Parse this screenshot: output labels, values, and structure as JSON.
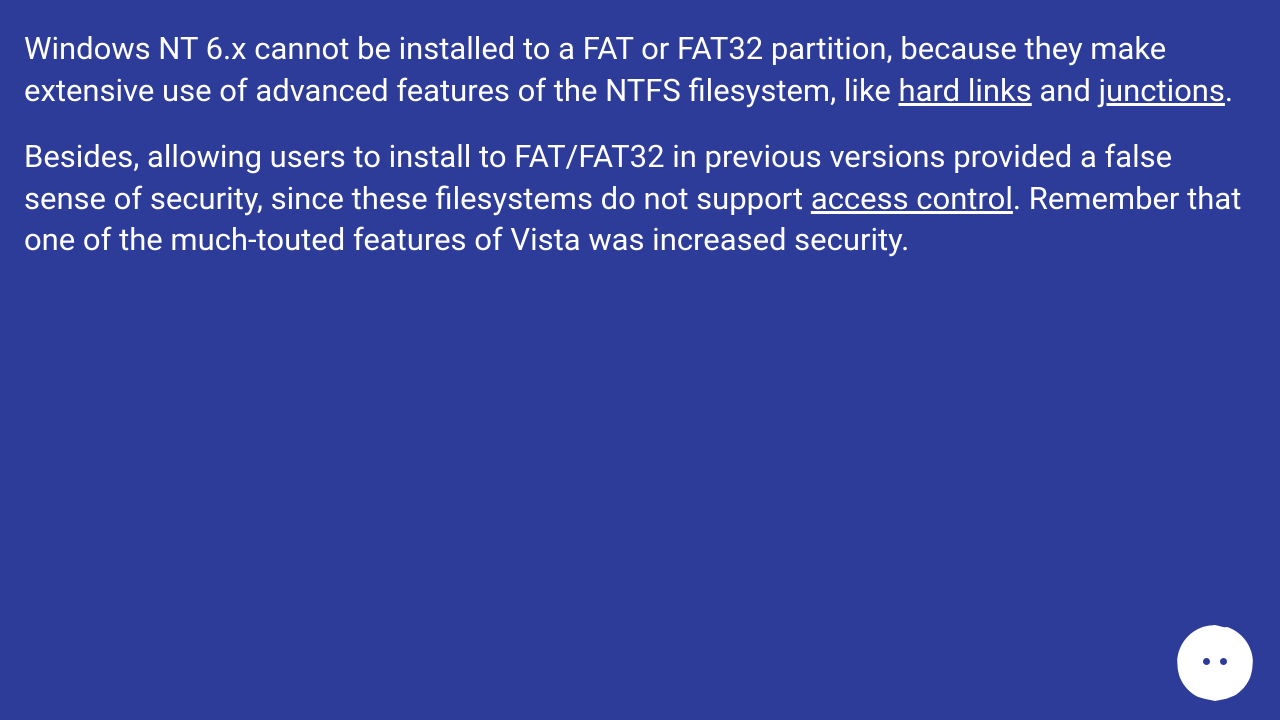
{
  "paragraphs": {
    "p1_seg1": "Windows NT 6.x cannot be installed to a FAT or FAT32 partition, because they make extensive use of advanced features of the NTFS filesystem, like ",
    "p1_link1": "hard links",
    "p1_seg2": " and ",
    "p1_link2": "junctions",
    "p1_seg3": ".",
    "p2_seg1": "Besides, allowing users to install to FAT/FAT32 in previous versions provided a false sense of security, since these filesystems do not support ",
    "p2_link1": "access control",
    "p2_seg2": ". Remember that one of the much-touted features of Vista was increased security."
  }
}
